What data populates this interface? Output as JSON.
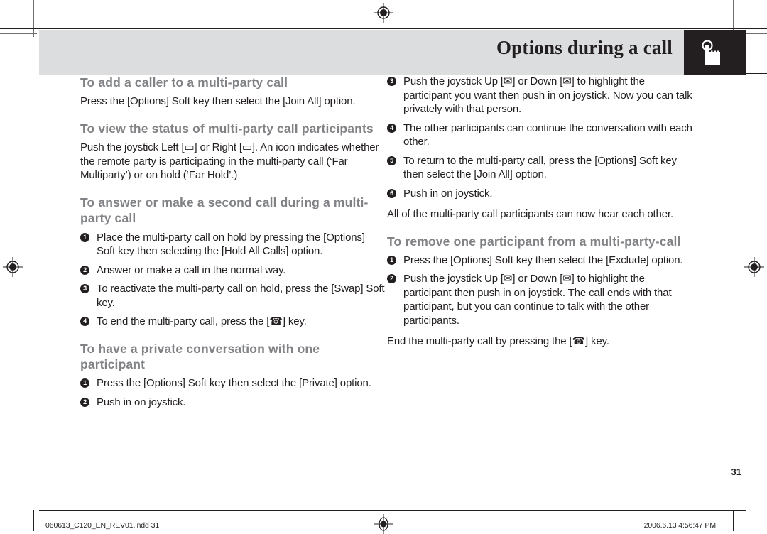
{
  "header": {
    "title": "Options during a call",
    "icon": "hand-press-icon",
    "band_color": "#dcdddf",
    "icon_box_color": "#231f20"
  },
  "colors": {
    "heading_gray": "#808285",
    "body_black": "#231f20",
    "band_gray": "#dcdddf"
  },
  "left_column": {
    "sections": [
      {
        "heading": "To add a caller to a multi-party call",
        "paragraphs": [
          "Press the [Options] Soft key then select the [Join All] option."
        ],
        "steps": []
      },
      {
        "heading": "To view the status of multi-party call participants",
        "paragraphs": [
          "Push the joystick Left [▭] or Right [▭]. An icon indicates whether the remote party is participating in the multi-party call (‘Far Multiparty’) or on hold (‘Far Hold’.)"
        ],
        "steps": []
      },
      {
        "heading": "To answer or make a second call during a multi-party call",
        "paragraphs": [],
        "steps": [
          {
            "num": "1",
            "text": "Place the multi-party call on hold by pressing the [Options] Soft key then selecting the [Hold All Calls] option."
          },
          {
            "num": "2",
            "text": "Answer or make a call in the normal way."
          },
          {
            "num": "3",
            "text": "To reactivate the multi-party call on hold, press the [Swap] Soft key."
          },
          {
            "num": "4",
            "text": "To end the multi-party call, press the [☎] key."
          }
        ]
      },
      {
        "heading": "To have a private conversation with one participant",
        "paragraphs": [],
        "steps": [
          {
            "num": "1",
            "text": "Press the [Options] Soft key then select the [Private] option."
          },
          {
            "num": "2",
            "text": "Push in on joystick."
          }
        ]
      }
    ]
  },
  "right_column": {
    "continued_steps": [
      {
        "num": "3",
        "text": "Push the joystick Up [✉] or Down [✉] to highlight the participant you want then push in on joystick. Now you can talk privately with that person."
      },
      {
        "num": "4",
        "text": "The other participants can continue the conversation with each other."
      },
      {
        "num": "5",
        "text": "To return to the multi-party call, press the [Options] Soft key then select the [Join All] option."
      },
      {
        "num": "6",
        "text": "Push in on joystick."
      }
    ],
    "after_steps_paragraph": "All of the multi-party call participants can now hear each other.",
    "sections": [
      {
        "heading": "To remove one participant from a multi-party-call",
        "steps": [
          {
            "num": "1",
            "text": "Press the [Options] Soft key then select the [Exclude] option."
          },
          {
            "num": "2",
            "text": "Push the joystick Up [✉] or Down [✉] to highlight the participant then push in on joystick. The call ends with that participant, but you can continue to talk with the other participants."
          }
        ],
        "closing_paragraph": "End the multi-party call by pressing the [☎] key."
      }
    ]
  },
  "page_number": "31",
  "footer": {
    "left_text": "060613_C120_EN_REV01.indd   31",
    "right_text": "2006.6.13   4:56:47 PM",
    "center_mark": "registration-mark"
  }
}
